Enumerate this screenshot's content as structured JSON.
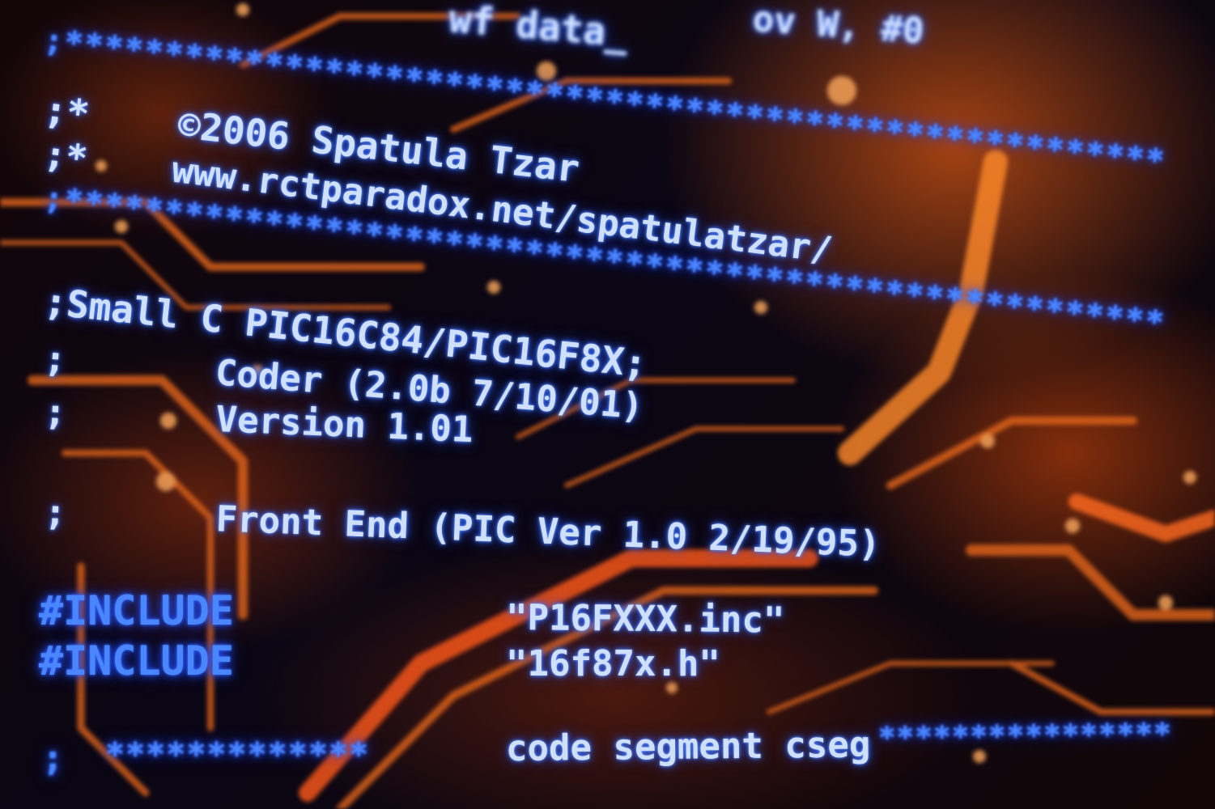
{
  "colors": {
    "code_text": "#cfe0ff",
    "code_glow": "#2f63ff",
    "keyword_blue": "#4a86ff",
    "trace_orange": "#e2651c",
    "background": "#05040e"
  },
  "code": {
    "line_top_fragment": "wf data_",
    "line_top_right_fragment": "ov W, #0",
    "line_bottom_fragment": "_",
    "border_1": ";*******************************************************",
    "copyright": ";*    ©2006 Spatula Tzar",
    "url": ";*    www.rctparadox.net/spatulatzar/",
    "border_2": ";*******************************************************",
    "small_c": ";Small C PIC16C84/PIC16F8X;",
    "coder": ";       Coder (2.0b 7/10/01)",
    "version": ";       Version 1.01",
    "front_end": ";       Front End (PIC Ver 1.0 2/19/95)",
    "include_1_keyword": "#INCLUDE",
    "include_1_file": "\"P16FXXX.inc\"",
    "include_2_keyword": "#INCLUDE",
    "include_2_file": "\"16f87x.h\"",
    "segment_prefix": ";",
    "segment_stars_left": "*************",
    "segment_label": "code segment cseg",
    "segment_stars_right": "****************"
  }
}
